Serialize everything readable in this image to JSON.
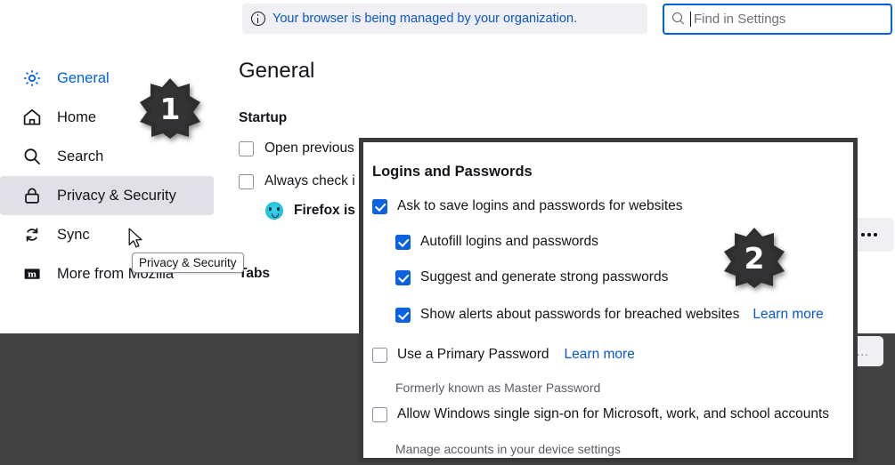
{
  "window": {
    "app": "Firefox Settings",
    "notice": {
      "icon": "info-circle-icon",
      "text": "Your browser is being managed by your organization."
    },
    "search": {
      "icon": "search-icon",
      "placeholder": "Find in Settings",
      "value": ""
    }
  },
  "sidebar": {
    "items": [
      {
        "label": "General",
        "icon": "gear-icon",
        "selected": true,
        "active": false
      },
      {
        "label": "Home",
        "icon": "home-icon",
        "selected": false,
        "active": false
      },
      {
        "label": "Search",
        "icon": "search-icon",
        "selected": false,
        "active": false
      },
      {
        "label": "Privacy & Security",
        "icon": "lock-icon",
        "selected": false,
        "active": true
      },
      {
        "label": "Sync",
        "icon": "sync-icon",
        "selected": false,
        "active": false
      },
      {
        "label": "More from Mozilla",
        "icon": "mozilla-icon",
        "selected": false,
        "active": false
      }
    ]
  },
  "main": {
    "page_title": "General",
    "startup": {
      "heading": "Startup",
      "checkboxes": [
        {
          "label": "Open previous",
          "checked": false
        },
        {
          "label": "Always check i",
          "checked": false
        }
      ],
      "firefox_note": "Firefox is",
      "firefox_icon": "firefox-sad-icon"
    },
    "tabs_heading": "Tabs",
    "ellipsis_button": {
      "icon": "more-options-icon",
      "label": "..."
    }
  },
  "dialog": {
    "title": "Logins and Passwords",
    "rows": [
      {
        "type": "checkbox",
        "label": "Ask to save logins and passwords for websites",
        "checked": true,
        "indent": 0
      },
      {
        "type": "checkbox",
        "label": "Autofill logins and passwords",
        "checked": true,
        "indent": 1
      },
      {
        "type": "checkbox",
        "label": "Suggest and generate strong passwords",
        "checked": true,
        "indent": 1
      },
      {
        "type": "checkbox",
        "label": "Show alerts about passwords for breached websites",
        "checked": true,
        "indent": 1,
        "link": "Learn more"
      },
      {
        "type": "checkbox",
        "label": "Use a Primary Password",
        "checked": false,
        "indent": 0,
        "link": "Learn more"
      },
      {
        "type": "subtext",
        "label": "Formerly known as Master Password"
      },
      {
        "type": "checkbox",
        "label": "Allow Windows single sign-on for Microsoft, work, and school accounts",
        "checked": false,
        "indent": 0
      },
      {
        "type": "subtext",
        "label": "Manage accounts in your device settings"
      }
    ],
    "change_button": "Change…"
  },
  "annotations": {
    "badges": [
      {
        "number": "1"
      },
      {
        "number": "2"
      }
    ],
    "tooltip": "Privacy & Security",
    "cursor": "mouse-pointer"
  },
  "colors": {
    "accent": "#0060df",
    "link": "#0a58ca",
    "checkbox_on": "#0a62e0",
    "selected_row": "#e0e0e6",
    "notice_bg": "#f0f0f4",
    "overlay": "#424242",
    "dialog_border": "#3a3a3c",
    "badge": "#2e2e2e"
  }
}
